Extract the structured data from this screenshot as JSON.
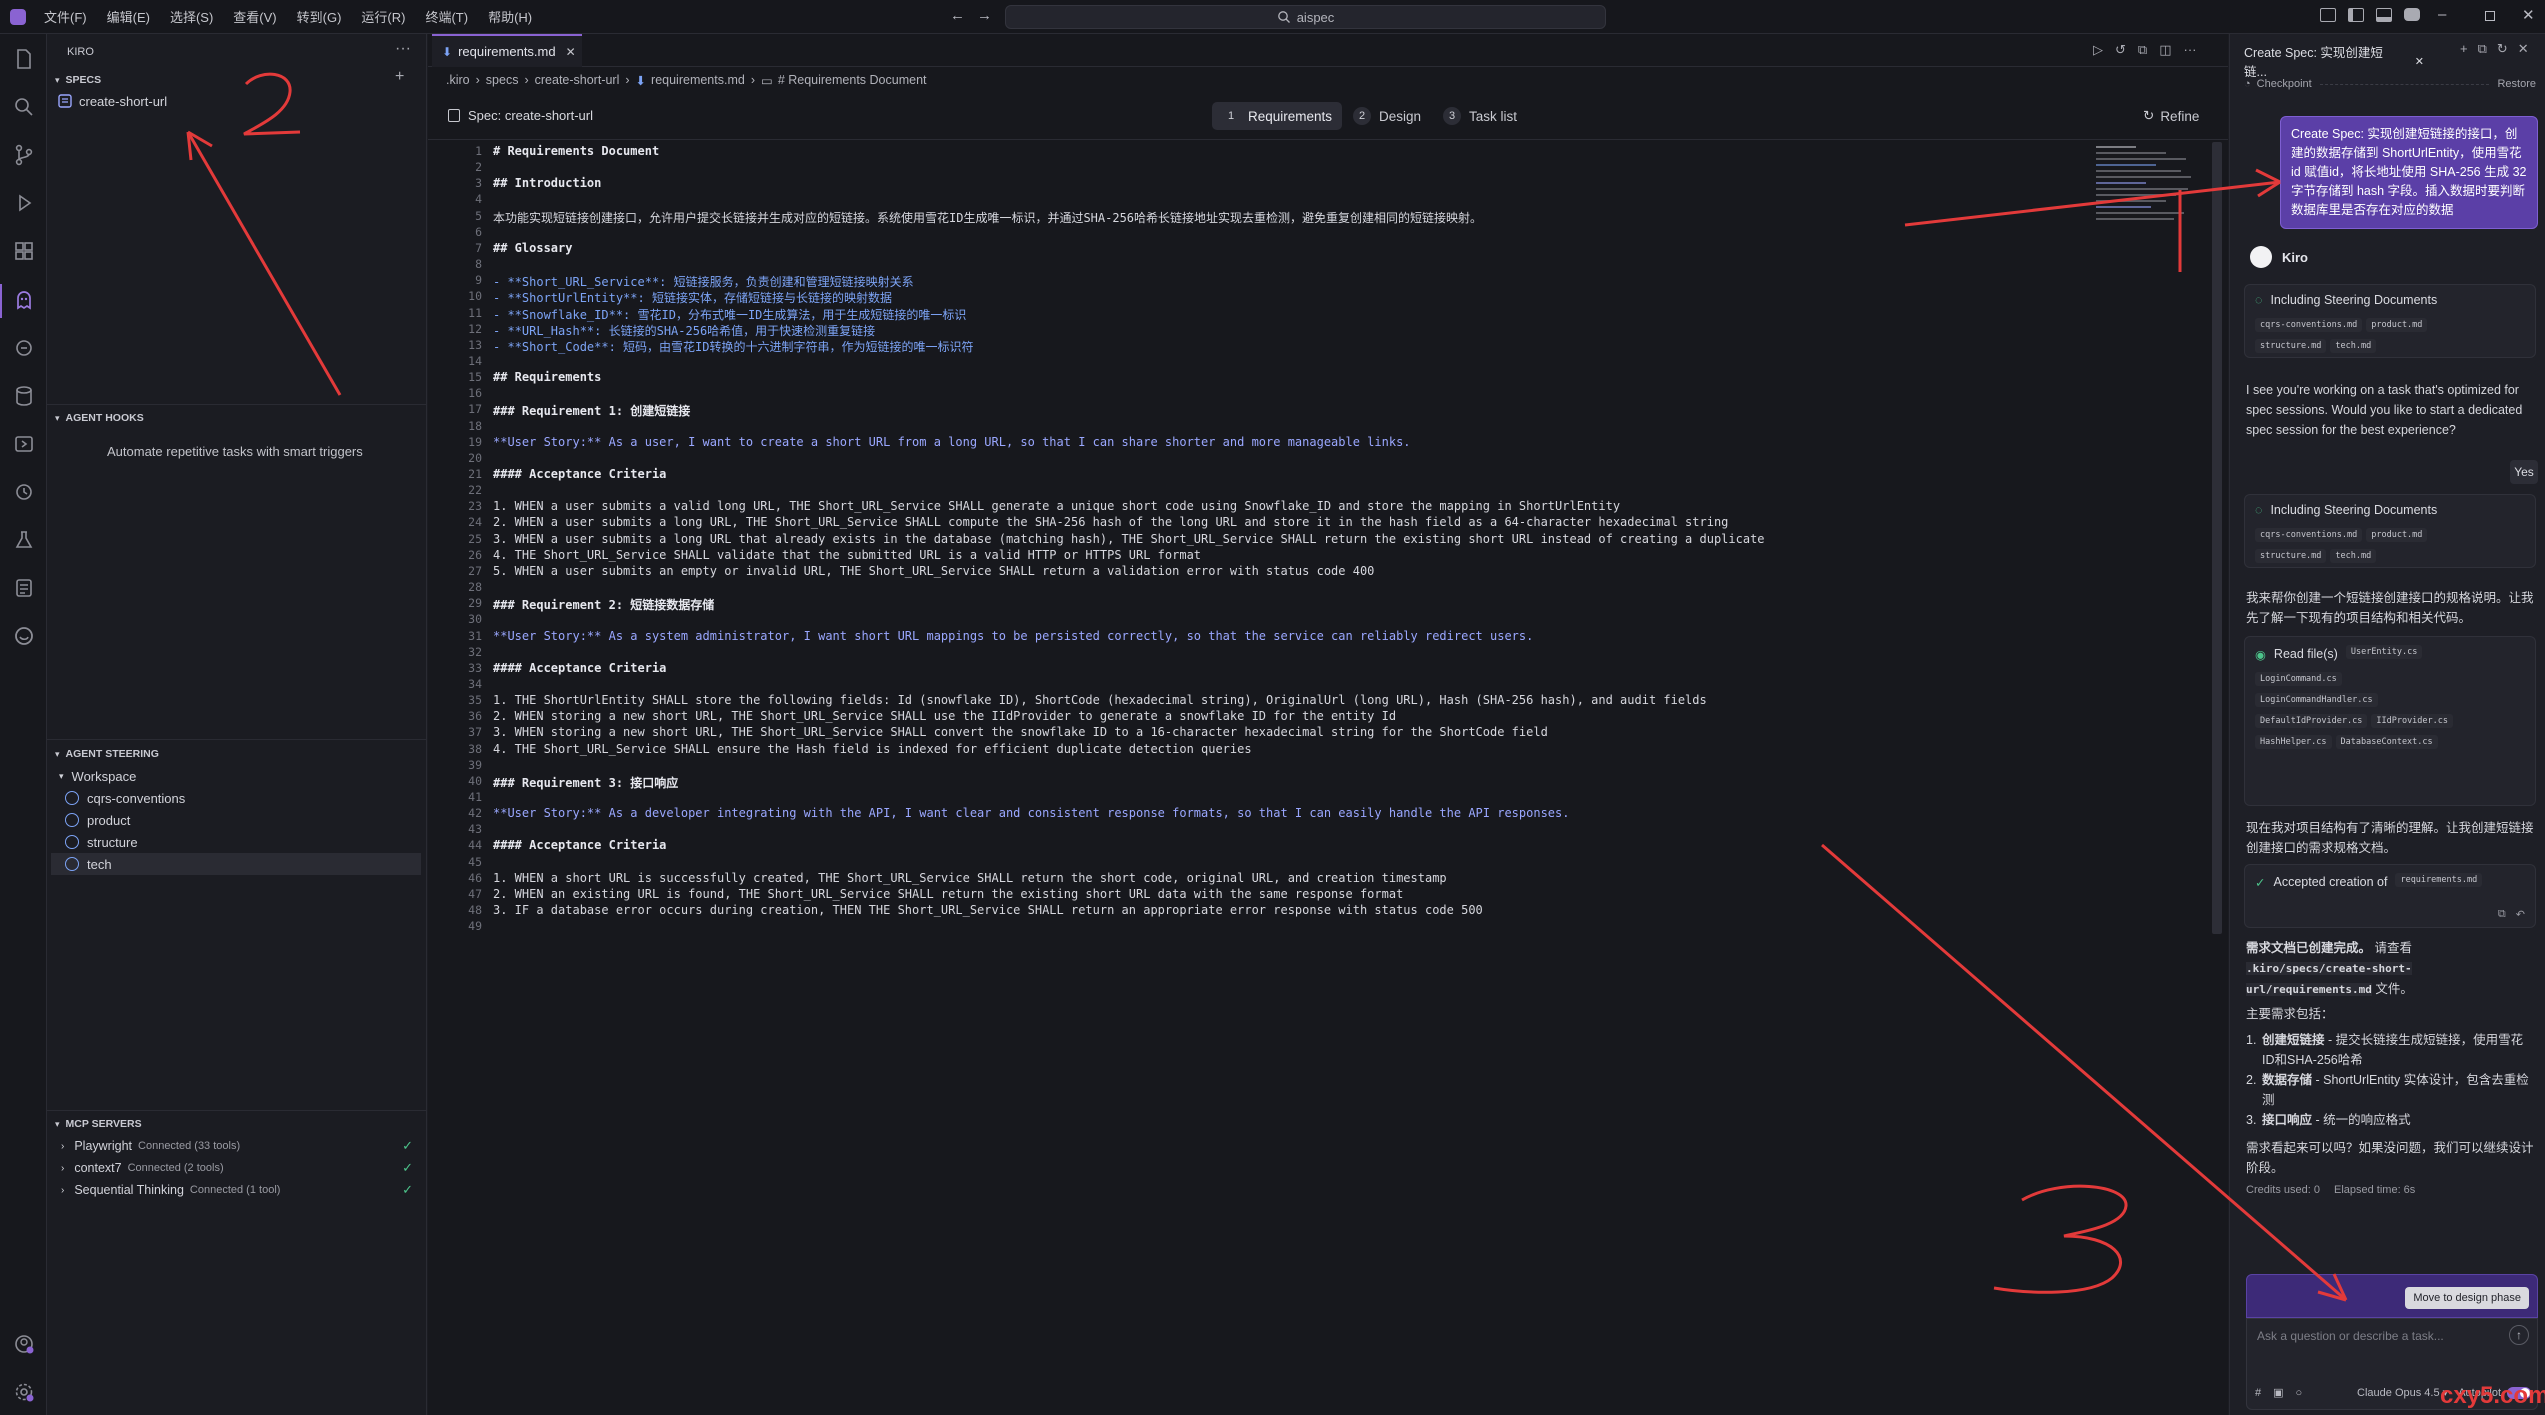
{
  "titlebar": {
    "menu": [
      "文件(F)",
      "编辑(E)",
      "选择(S)",
      "查看(V)",
      "转到(G)",
      "运行(R)",
      "终端(T)",
      "帮助(H)"
    ],
    "search_text": "aispec"
  },
  "sidebar": {
    "title": "KIRO",
    "specs_header": "SPECS",
    "specs": [
      "create-short-url"
    ],
    "hooks_header": "AGENT HOOKS",
    "hooks_hint": "Automate repetitive tasks with smart triggers",
    "steering_header": "AGENT STEERING",
    "workspace_label": "Workspace",
    "steering_items": [
      "cqrs-conventions",
      "product",
      "structure",
      "tech"
    ],
    "mcp_header": "MCP SERVERS",
    "mcp_servers": [
      {
        "name": "Playwright",
        "status": "Connected (33 tools)"
      },
      {
        "name": "context7",
        "status": "Connected (2 tools)"
      },
      {
        "name": "Sequential Thinking",
        "status": "Connected (1 tool)"
      }
    ]
  },
  "editor": {
    "tab_label": "requirements.md",
    "breadcrumb": [
      ".kiro",
      "specs",
      "create-short-url",
      "requirements.md",
      "# Requirements Document"
    ],
    "spec_title": "Spec: create-short-url",
    "steps": [
      {
        "num": "1",
        "label": "Requirements"
      },
      {
        "num": "2",
        "label": "Design"
      },
      {
        "num": "3",
        "label": "Task list"
      }
    ],
    "refine_label": "Refine",
    "lines": [
      "# Requirements Document",
      "",
      "## Introduction",
      "",
      "本功能实现短链接创建接口，允许用户提交长链接并生成对应的短链接。系统使用雪花ID生成唯一标识，并通过SHA-256哈希长链接地址实现去重检测，避免重复创建相同的短链接映射。",
      "",
      "## Glossary",
      "",
      "- **Short_URL_Service**: 短链接服务，负责创建和管理短链接映射关系",
      "- **ShortUrlEntity**: 短链接实体，存储短链接与长链接的映射数据",
      "- **Snowflake_ID**: 雪花ID，分布式唯一ID生成算法，用于生成短链接的唯一标识",
      "- **URL_Hash**: 长链接的SHA-256哈希值，用于快速检测重复链接",
      "- **Short_Code**: 短码，由雪花ID转换的十六进制字符串，作为短链接的唯一标识符",
      "",
      "## Requirements",
      "",
      "### Requirement 1: 创建短链接",
      "",
      "**User Story:** As a user, I want to create a short URL from a long URL, so that I can share shorter and more manageable links.",
      "",
      "#### Acceptance Criteria",
      "",
      "1. WHEN a user submits a valid long URL, THE Short_URL_Service SHALL generate a unique short code using Snowflake_ID and store the mapping in ShortUrlEntity",
      "2. WHEN a user submits a long URL, THE Short_URL_Service SHALL compute the SHA-256 hash of the long URL and store it in the hash field as a 64-character hexadecimal string",
      "3. WHEN a user submits a long URL that already exists in the database (matching hash), THE Short_URL_Service SHALL return the existing short URL instead of creating a duplicate",
      "4. THE Short_URL_Service SHALL validate that the submitted URL is a valid HTTP or HTTPS URL format",
      "5. WHEN a user submits an empty or invalid URL, THE Short_URL_Service SHALL return a validation error with status code 400",
      "",
      "### Requirement 2: 短链接数据存储",
      "",
      "**User Story:** As a system administrator, I want short URL mappings to be persisted correctly, so that the service can reliably redirect users.",
      "",
      "#### Acceptance Criteria",
      "",
      "1. THE ShortUrlEntity SHALL store the following fields: Id (snowflake ID), ShortCode (hexadecimal string), OriginalUrl (long URL), Hash (SHA-256 hash), and audit fields",
      "2. WHEN storing a new short URL, THE Short_URL_Service SHALL use the IIdProvider to generate a snowflake ID for the entity Id",
      "3. WHEN storing a new short URL, THE Short_URL_Service SHALL convert the snowflake ID to a 16-character hexadecimal string for the ShortCode field",
      "4. THE Short_URL_Service SHALL ensure the Hash field is indexed for efficient duplicate detection queries",
      "",
      "### Requirement 3: 接口响应",
      "",
      "**User Story:** As a developer integrating with the API, I want clear and consistent response formats, so that I can easily handle the API responses.",
      "",
      "#### Acceptance Criteria",
      "",
      "1. WHEN a short URL is successfully created, THE Short_URL_Service SHALL return the short code, original URL, and creation timestamp",
      "2. WHEN an existing URL is found, THE Short_URL_Service SHALL return the existing short URL data with the same response format",
      "3. IF a database error occurs during creation, THEN THE Short_URL_Service SHALL return an appropriate error response with status code 500",
      ""
    ]
  },
  "chat": {
    "tab_title": "Create Spec: 实现创建短链...",
    "checkpoint_label": "Checkpoint",
    "restore_label": "Restore",
    "user_message": "Create Spec: 实现创建短链接的接口，创建的数据存储到 ShortUrlEntity，使用雪花id 赋值id，将长地址使用 SHA-256 生成 32 字节存储到 hash 字段。插入数据时要判断数据库里是否存在对应的数据",
    "agent_name": "Kiro",
    "steering_title": "Including Steering Documents",
    "steering_docs": [
      "cqrs-conventions.md",
      "product.md",
      "structure.md",
      "tech.md"
    ],
    "msg1": "I see you're working on a task that's optimized for spec sessions. Would you like to start a dedicated spec session for the best experience?",
    "yes_label": "Yes",
    "msg2": "我来帮你创建一个短链接创建接口的规格说明。让我先了解一下现有的项目结构和相关代码。",
    "read_files_label": "Read file(s)",
    "read_files": [
      "UserEntity.cs",
      "LoginCommand.cs",
      "LoginCommandHandler.cs",
      "DefaultIdProvider.cs",
      "IIdProvider.cs",
      "HashHelper.cs",
      "DatabaseContext.cs"
    ],
    "msg3": "现在我对项目结构有了清晰的理解。让我创建短链接创建接口的需求规格文档。",
    "accepted_label": "Accepted creation of",
    "accepted_file": "requirements.md",
    "done_title": "需求文档已创建完成。",
    "done_text": "请查看",
    "done_path": ".kiro/specs/create-short-url/requirements.md",
    "done_suffix": "文件。",
    "summary_title": "主要需求包括：",
    "summary_items": [
      {
        "bold": "创建短链接",
        "text": " - 提交长链接生成短链接，使用雪花ID和SHA-256哈希"
      },
      {
        "bold": "数据存储",
        "text": " - ShortUrlEntity 实体设计，包含去重检测"
      },
      {
        "bold": "接口响应",
        "text": " - 统一的响应格式"
      }
    ],
    "msg4": "需求看起来可以吗？如果没问题，我们可以继续设计阶段。",
    "credits": "Credits used: 0",
    "elapsed": "Elapsed time: 6s",
    "move_label": "Move to design phase",
    "input_placeholder": "Ask a question or describe a task...",
    "model": "Claude Opus 4.5",
    "autopilot": "Autopilot"
  },
  "watermark": "cxy5.com"
}
